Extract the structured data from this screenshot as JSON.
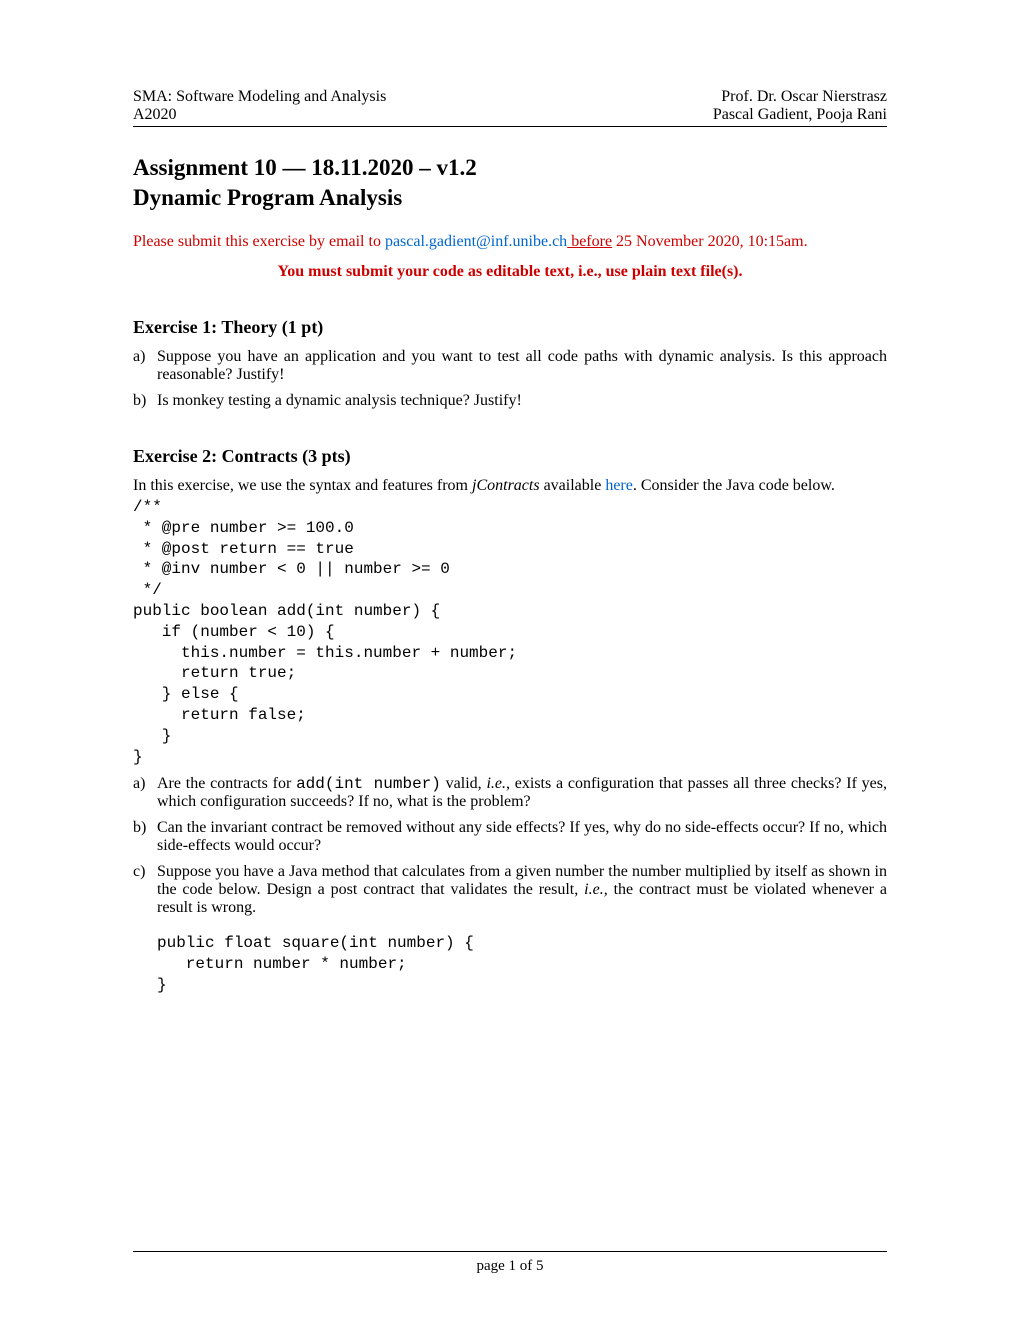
{
  "header": {
    "left_line1": "SMA: Software Modeling and Analysis",
    "left_line2": "A2020",
    "right_line1": "Prof. Dr. Oscar Nierstrasz",
    "right_line2": "Pascal Gadient, Pooja Rani"
  },
  "title": {
    "line1": "Assignment 10 — 18.11.2020 – v1.2",
    "line2": "Dynamic Program Analysis"
  },
  "submission": {
    "prefix": "Please submit this exercise by email to ",
    "email": "pascal.gadient@inf.unibe.ch",
    "before": " before",
    "suffix": " 25 November 2020, 10:15am."
  },
  "bold_notice": "You must submit your code as editable text, i.e., use plain text file(s).",
  "exercise1": {
    "header": "Exercise 1: Theory (1 pt)",
    "a_label": "a)",
    "a_text": "Suppose you have an application and you want to test all code paths with dynamic analysis. Is this approach reasonable? Justify!",
    "b_label": "b)",
    "b_text": "Is monkey testing a dynamic analysis technique? Justify!"
  },
  "exercise2": {
    "header": "Exercise 2: Contracts (3 pts)",
    "intro_part1": "In this exercise, we use the syntax and features from ",
    "intro_italic": "jContracts",
    "intro_part2": " available ",
    "intro_link": "here",
    "intro_part3": ". Consider the Java code below.",
    "code1": "/**\n * @pre number >= 100.0\n * @post return == true\n * @inv number < 0 || number >= 0\n */\npublic boolean add(int number) {\n   if (number < 10) {\n     this.number = this.number + number;\n     return true;\n   } else {\n     return false;\n   }\n}",
    "a_label": "a)",
    "a_part1": "Are the contracts for ",
    "a_code": "add(int number)",
    "a_part2": " valid, ",
    "a_italic": "i.e.,",
    "a_part3": " exists a configuration that passes all three checks? If yes, which configuration succeeds? If no, what is the problem?",
    "b_label": "b)",
    "b_text": "Can the invariant contract be removed without any side effects? If yes, why do no side-effects occur? If no, which side-effects would occur?",
    "c_label": "c)",
    "c_part1": "Suppose you have a Java method that calculates from a given number the number multiplied by itself as shown in the code below. Design a post contract that validates the result, ",
    "c_italic": "i.e.,",
    "c_part2": " the contract must be violated whenever a result is wrong.",
    "code2": "public float square(int number) {\n   return number * number;\n}"
  },
  "footer": "page 1 of 5"
}
